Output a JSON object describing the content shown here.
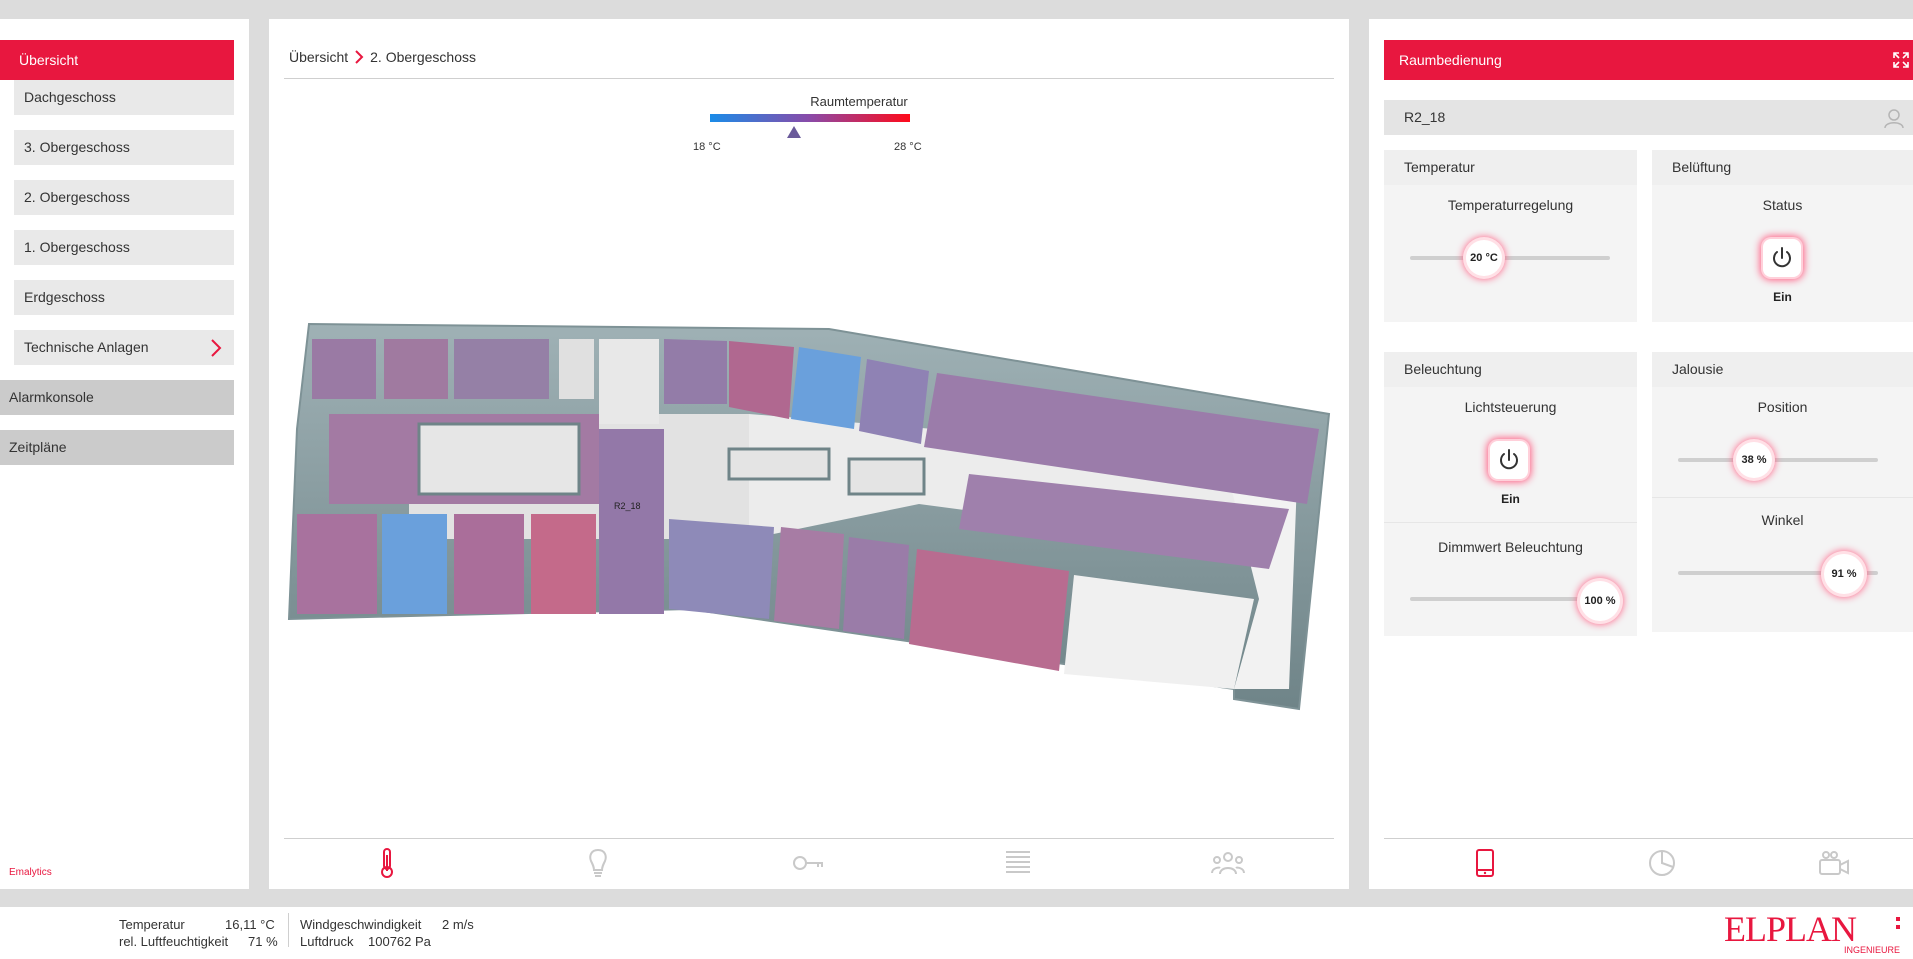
{
  "sidebar": {
    "header": "Übersicht",
    "floors": [
      "Dachgeschoss",
      "3. Obergeschoss",
      "2. Obergeschoss",
      "1. Obergeschoss",
      "Erdgeschoss",
      "Technische Anlagen"
    ],
    "sections": [
      "Alarmkonsole",
      "Zeitpläne"
    ],
    "brand": "Emalytics"
  },
  "breadcrumb": {
    "root": "Übersicht",
    "current": "2. Obergeschoss"
  },
  "legend": {
    "title": "Raumtemperatur",
    "min": "18 °C",
    "max": "28 °C",
    "current_fraction": 0.42
  },
  "floorplan": {
    "room_label": "R2_18"
  },
  "center_tabs": [
    "thermometer-icon",
    "bulb-icon",
    "key-icon",
    "blinds-icon",
    "people-icon"
  ],
  "right_panel": {
    "title": "Raumbedienung",
    "room": "R2_18",
    "temperature": {
      "title": "Temperatur",
      "control_label": "Temperaturregelung",
      "value": "20 °C",
      "fraction": 0.37
    },
    "ventilation": {
      "title": "Belüftung",
      "status_label": "Status",
      "state": "Ein"
    },
    "lighting": {
      "title": "Beleuchtung",
      "control_label": "Lichtsteuerung",
      "state": "Ein",
      "dim_label": "Dimmwert Beleuchtung",
      "dim_value": "100 %",
      "dim_fraction": 1.0
    },
    "blinds": {
      "title": "Jalousie",
      "position_label": "Position",
      "position_value": "38 %",
      "position_fraction": 0.38,
      "angle_label": "Winkel",
      "angle_value": "91 %",
      "angle_fraction": 0.91
    },
    "tabs": [
      "mobile-icon",
      "pie-chart-icon",
      "camera-icon"
    ]
  },
  "footer": {
    "temp_label": "Temperatur",
    "temp_value": "16,11 °C",
    "humidity_label": "rel. Luftfeuchtigkeit",
    "humidity_value": "71 %",
    "wind_label": "Windgeschwindigkeit",
    "wind_value": "2 m/s",
    "pressure_label": "Luftdruck",
    "pressure_value": "100762 Pa",
    "logo_text": "ELPLAN",
    "logo_sub": "INGENIEURE"
  },
  "colors": {
    "accent": "#e8173f",
    "cold": "#1a8ce8",
    "warm": "#ff0a1a"
  }
}
